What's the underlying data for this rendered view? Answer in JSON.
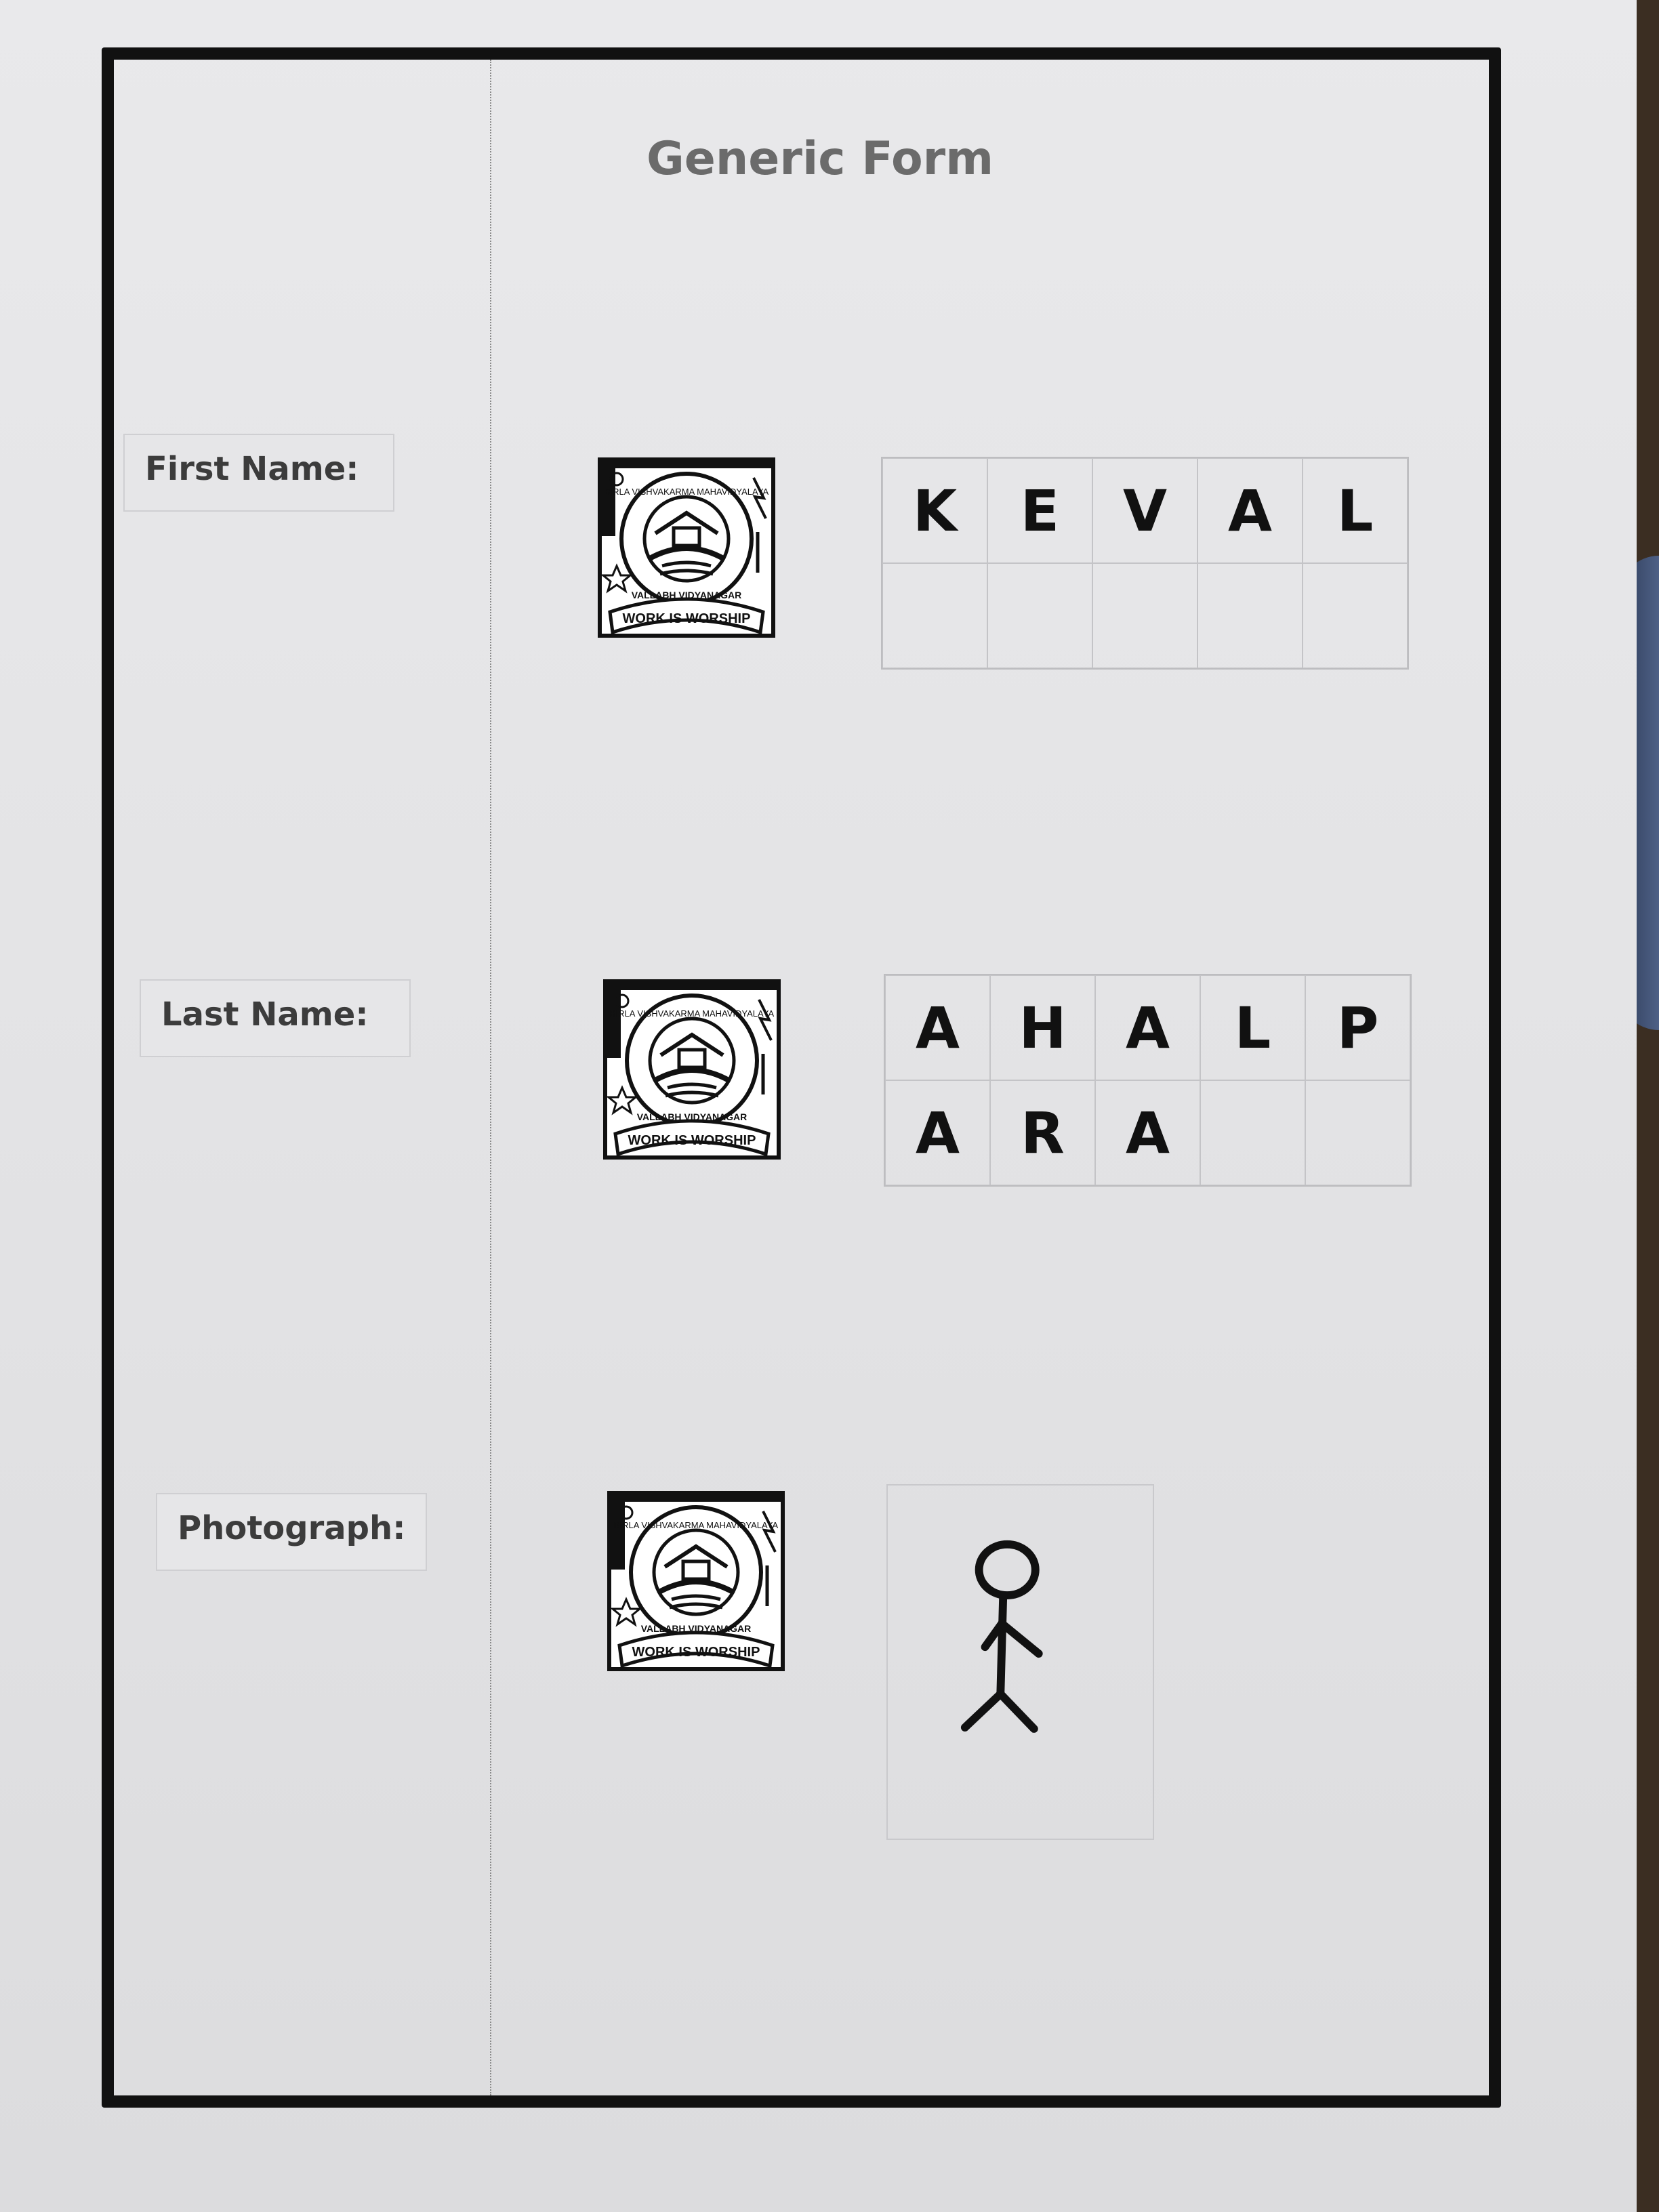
{
  "form": {
    "title": "Generic Form",
    "fields": [
      {
        "label": "First Name:",
        "letters": [
          "K",
          "E",
          "V",
          "A",
          "L",
          "",
          "",
          "",
          "",
          ""
        ]
      },
      {
        "label": "Last Name:",
        "letters": [
          "A",
          "H",
          "A",
          "L",
          "P",
          "A",
          "R",
          "A",
          "",
          ""
        ]
      },
      {
        "label": "Photograph:"
      }
    ],
    "seal": {
      "top_text": "BIRLA VISHVAKARMA MAHAVIDYALAYA",
      "bottom_text": "VALLABH VIDYANAGAR",
      "motto": "WORK IS WORSHIP"
    },
    "photo_icon": "stick-figure-icon"
  }
}
